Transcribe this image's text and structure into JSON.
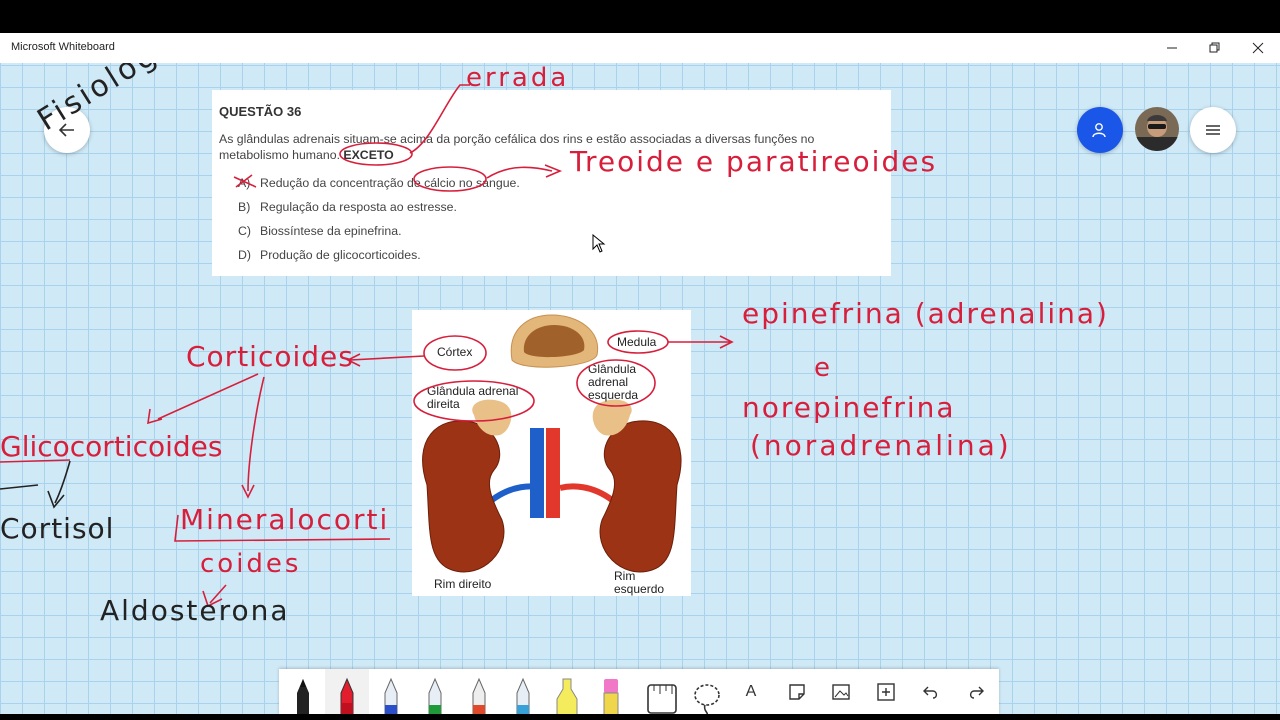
{
  "window": {
    "title": "Microsoft Whiteboard"
  },
  "question": {
    "title": "QUESTÃO 36",
    "text_before": "As glândulas adrenais situam-se acima da porção cefálica dos rins e estão associadas a diversas funções no metabolismo humano.",
    "text_emph": "EXCETO",
    "options": [
      {
        "letter": "A)",
        "text": "Redução da concentração de cálcio no sangue."
      },
      {
        "letter": "B)",
        "text": "Regulação da resposta ao estresse."
      },
      {
        "letter": "C)",
        "text": "Biossíntese da epinefrina."
      },
      {
        "letter": "D)",
        "text": "Produção de glicocorticoides."
      }
    ]
  },
  "diagram_labels": {
    "cortex": "Córtex",
    "medula": "Medula",
    "right_gland": "Glândula adrenal direita",
    "left_gland": "Glândula adrenal esquerda",
    "right_kidney": "Rim direito",
    "left_kidney": "Rim esquerdo"
  },
  "ink": {
    "fisiologia": "Fisiologia",
    "errada": "errada",
    "tireoide": "Treoide e paratireoides",
    "corticoides": "Corticoides",
    "glicocorticoides": "Glicocorticoides",
    "cortisol": "Cortisol",
    "mineralo1": "Mineralocorti",
    "mineralo2": "coides",
    "aldosterona": "Aldosterona",
    "epinefrina": "epinefrina (adrenalina)",
    "e": "e",
    "norepinefrina": "norepinefrina",
    "noradrenalina": "(noradrenalina)"
  },
  "toolbar": {
    "tools": [
      "black-pen",
      "red-pen",
      "blue-pen",
      "green-pen",
      "red-pencil",
      "blue-pen-2",
      "yellow-highlighter",
      "pink-highlighter",
      "ruler",
      "lasso",
      "text",
      "sticky-note",
      "image",
      "add",
      "undo",
      "redo"
    ],
    "text_tool_glyph": "A"
  },
  "colors": {
    "ink_red": "#d71f3c",
    "accent_blue": "#1a56e8",
    "board": "#cfe9f7"
  }
}
